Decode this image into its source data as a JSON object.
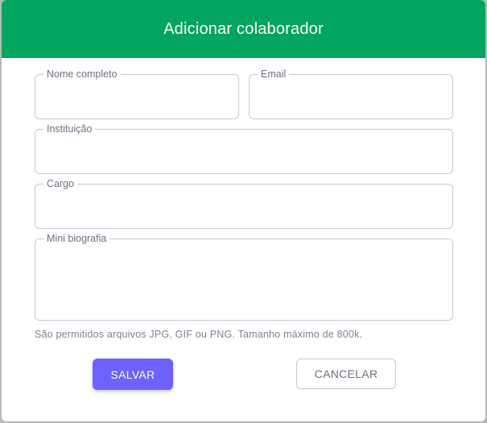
{
  "modal": {
    "title": "Adicionar colaborador",
    "colors": {
      "header": "#02a55f",
      "primary_button": "#6c63ff",
      "overlay": "#b9b9bb"
    }
  },
  "form": {
    "full_name": {
      "label": "Nome completo",
      "value": ""
    },
    "email": {
      "label": "Email",
      "value": ""
    },
    "institution": {
      "label": "Instituição",
      "value": ""
    },
    "role": {
      "label": "Cargo",
      "value": ""
    },
    "bio": {
      "label": "Mini biografia",
      "value": ""
    },
    "helper_text": "São permitidos arquivos JPG, GIF ou PNG. Tamanho máximo de 800k."
  },
  "actions": {
    "save_label": "SALVAR",
    "cancel_label": "CANCELAR"
  }
}
